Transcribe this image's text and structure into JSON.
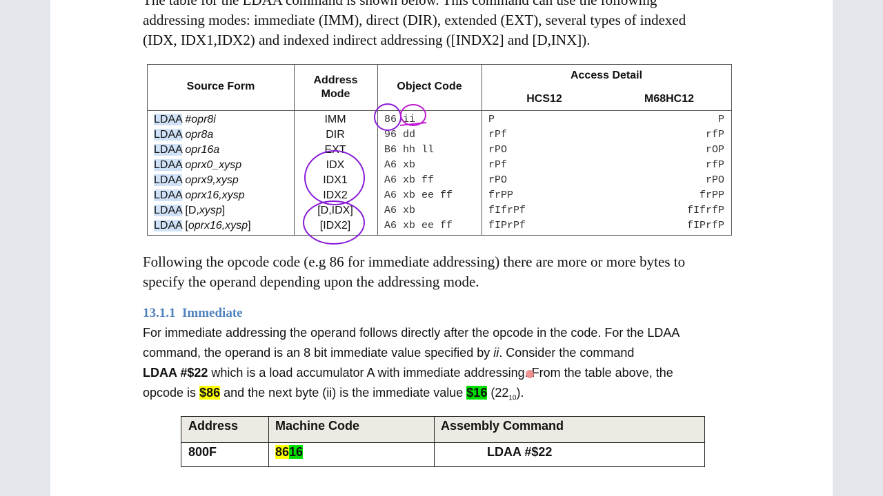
{
  "intro": {
    "line1": "The table for the LDAA command is shown below.  This command can use the following",
    "line2": "addressing modes: immediate (IMM), direct (DIR), extended (EXT), several types of indexed",
    "line3": "(IDX, IDX1,IDX2) and indexed indirect addressing ([INDX2] and [D,INX])."
  },
  "instruction_table": {
    "headers": {
      "source_form": "Source Form",
      "address_mode_1": "Address",
      "address_mode_2": "Mode",
      "object_code": "Object Code",
      "access_detail": "Access Detail",
      "hcs12": "HCS12",
      "m68hc12": "M68HC12"
    },
    "rows": [
      {
        "kw": "LDAA",
        "operand_pre": "#",
        "operand_it": "opr8i",
        "operand_post": "",
        "mode": "IMM",
        "obj": "86 ii",
        "hcs": "P",
        "m68": "P"
      },
      {
        "kw": "LDAA",
        "operand_pre": "",
        "operand_it": "opr8a",
        "operand_post": "",
        "mode": "DIR",
        "obj": "96 dd",
        "hcs": "rPf",
        "m68": "rfP"
      },
      {
        "kw": "LDAA",
        "operand_pre": "",
        "operand_it": "opr16a",
        "operand_post": "",
        "mode": "EXT",
        "obj": "B6 hh ll",
        "hcs": "rPO",
        "m68": "rOP"
      },
      {
        "kw": "LDAA",
        "operand_pre": "",
        "operand_it": "oprx0_xysp",
        "operand_post": "",
        "mode": "IDX",
        "obj": "A6 xb",
        "hcs": "rPf",
        "m68": "rfP"
      },
      {
        "kw": "LDAA",
        "operand_pre": "",
        "operand_it": "oprx9,xysp",
        "operand_post": "",
        "mode": "IDX1",
        "obj": "A6 xb ff",
        "hcs": "rPO",
        "m68": "rPO"
      },
      {
        "kw": "LDAA",
        "operand_pre": "",
        "operand_it": "oprx16,xysp",
        "operand_post": "",
        "mode": "IDX2",
        "obj": "A6 xb ee ff",
        "hcs": "frPP",
        "m68": "frPP"
      },
      {
        "kw": "LDAA",
        "operand_pre": "[D,",
        "operand_it": "xysp",
        "operand_post": "]",
        "mode": "[D,IDX]",
        "obj": "A6 xb",
        "hcs": "fIfrPf",
        "m68": "fIfrfP"
      },
      {
        "kw": "LDAA",
        "operand_pre": "[",
        "operand_it": "oprx16,xysp",
        "operand_post": "]",
        "mode": "[IDX2]",
        "obj": "A6 xb ee ff",
        "hcs": "fIPrPf",
        "m68": "fIPrfP"
      }
    ]
  },
  "following": {
    "line1": "Following the opcode code (e.g 86 for immediate addressing) there are more or more bytes to",
    "line2": "specify the operand depending upon the addressing mode."
  },
  "section": {
    "number": "13.1.1",
    "title": "Immediate"
  },
  "immediate_para": {
    "line1": "For immediate addressing the operand follows directly after the opcode in the code.  For the LDAA",
    "line2_a": "command, the operand is an 8 bit immediate value specified by ",
    "line2_it": "ii",
    "line2_b": ".  Consider the command",
    "cmd": "LDAA #$22",
    "line3_b": " which is a load accumulator A with immediate addressing.  From the table above, the",
    "line4_a": "opcode is ",
    "opcode": "$86",
    "line4_b": " and the next byte (ii) is the immediate value ",
    "value": "$16",
    "line4_c": " (22",
    "sub": "10",
    "line4_d": ")."
  },
  "example_table": {
    "headers": {
      "address": "Address",
      "machine_code": "Machine Code",
      "assembly": "Assembly Command"
    },
    "row": {
      "address": "800F",
      "mc_a": "86",
      "mc_b": "16",
      "assembly": "LDAA #$22"
    }
  },
  "colors": {
    "heading": "#4f81bd",
    "keyword_highlight": "#cfe2f7",
    "yellow_highlight": "#ffff00",
    "green_highlight": "#00e000",
    "pen_annotation": "#8a1cd8"
  }
}
